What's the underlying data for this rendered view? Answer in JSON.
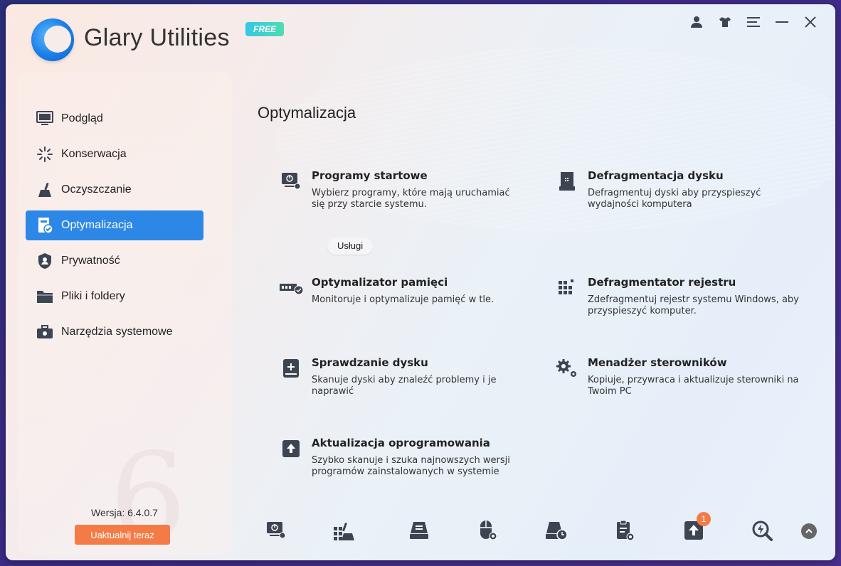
{
  "header": {
    "app_title": "Glary Utilities",
    "free_badge": "FREE",
    "icons": [
      "user-icon",
      "shirt-icon",
      "menu-icon",
      "minimize-icon",
      "close-icon"
    ]
  },
  "sidebar": {
    "items": [
      {
        "label": "Podgląd",
        "icon": "monitor-icon"
      },
      {
        "label": "Konserwacja",
        "icon": "sparkle-icon"
      },
      {
        "label": "Oczyszczanie",
        "icon": "broom-icon"
      },
      {
        "label": "Optymalizacja",
        "icon": "optimize-icon",
        "active": true
      },
      {
        "label": "Prywatność",
        "icon": "shield-icon"
      },
      {
        "label": "Pliki i foldery",
        "icon": "folder-icon"
      },
      {
        "label": "Narzędzia systemowe",
        "icon": "toolbox-icon"
      }
    ],
    "version": "Wersja: 6.4.0.7",
    "update_button": "Uaktualnij teraz"
  },
  "main": {
    "title": "Optymalizacja",
    "tools": [
      {
        "title": "Programy startowe",
        "desc": "Wybierz programy, które mają uruchamiać się przy starcie systemu.",
        "icon": "startup-icon"
      },
      {
        "title": "Defragmentacja dysku",
        "desc": "Defragmentuj dyski aby przyspieszyć wydajności komputera",
        "icon": "disk-defrag-icon"
      },
      {
        "title": "Optymalizator pamięci",
        "desc": "Monitoruje i optymalizuje pamięć w tle.",
        "icon": "memory-icon"
      },
      {
        "title": "Defragmentator rejestru",
        "desc": "Zdefragmentuj rejestr systemu Windows, aby przyspieszyć komputer.",
        "icon": "registry-defrag-icon"
      },
      {
        "title": "Sprawdzanie dysku",
        "desc": "Skanuje dyski aby znaleźć problemy i je naprawić",
        "icon": "disk-check-icon"
      },
      {
        "title": "Menadżer sterowników",
        "desc": "Kopiuje, przywraca i aktualizuje sterowniki na Twoim PC",
        "icon": "gears-icon"
      },
      {
        "title": "Aktualizacja oprogramowania",
        "desc": "Szybko skanuje i szuka najnowszych wersji programów zainstalowanych w systemie",
        "icon": "upload-icon"
      }
    ],
    "services_button": "Usługi"
  },
  "bottom_bar": {
    "items": [
      {
        "icon": "startup-icon"
      },
      {
        "icon": "registry-tool-icon"
      },
      {
        "icon": "disk-clean-icon"
      },
      {
        "icon": "mouse-settings-icon"
      },
      {
        "icon": "disk-schedule-icon"
      },
      {
        "icon": "clipboard-settings-icon"
      },
      {
        "icon": "update-icon",
        "badge": "1"
      },
      {
        "icon": "search-boost-icon"
      }
    ],
    "scroll_up_icon": "chevron-up-icon"
  },
  "colors": {
    "accent": "#2d87e6",
    "update": "#f47b45",
    "icon": "#3d4452"
  }
}
